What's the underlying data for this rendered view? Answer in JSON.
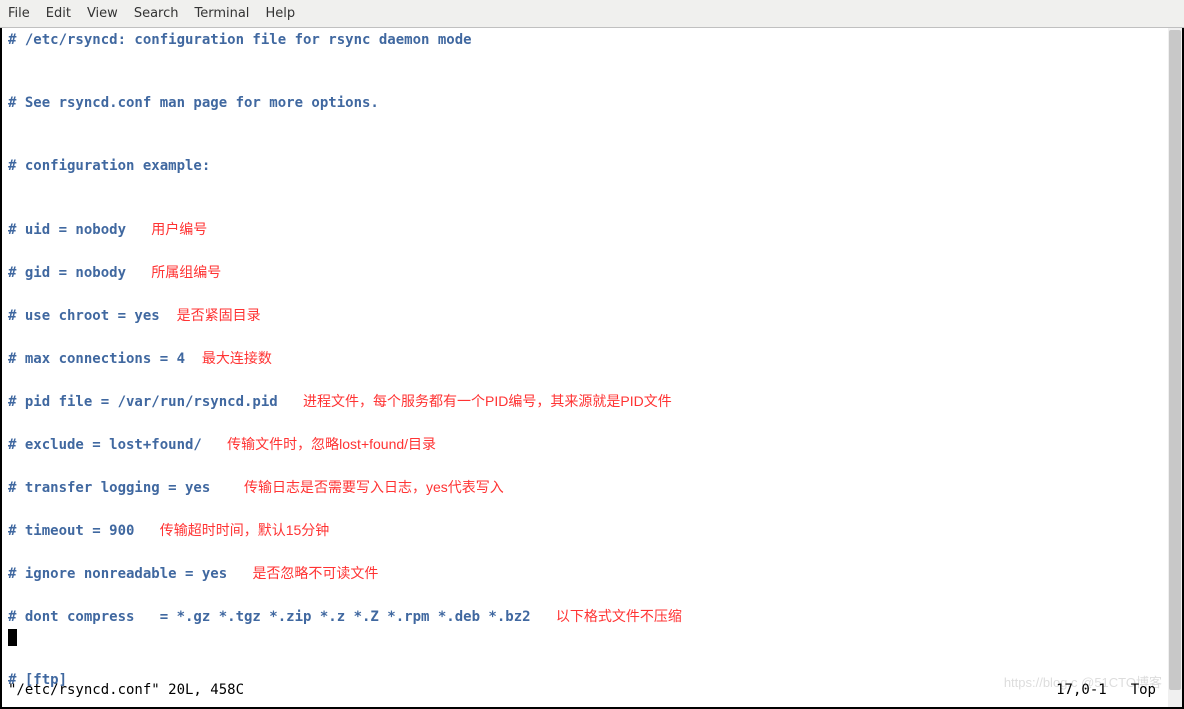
{
  "menubar": {
    "items": [
      {
        "label": "File"
      },
      {
        "label": "Edit"
      },
      {
        "label": "View"
      },
      {
        "label": "Search"
      },
      {
        "label": "Terminal"
      },
      {
        "label": "Help"
      }
    ]
  },
  "lines": [
    {
      "code": "# /etc/rsyncd: configuration file for rsync daemon mode",
      "note": ""
    },
    {
      "code": "",
      "note": ""
    },
    {
      "code": "",
      "note": ""
    },
    {
      "code": "# See rsyncd.conf man page for more options.",
      "note": ""
    },
    {
      "code": "",
      "note": ""
    },
    {
      "code": "",
      "note": ""
    },
    {
      "code": "# configuration example:",
      "note": ""
    },
    {
      "code": "",
      "note": ""
    },
    {
      "code": "",
      "note": ""
    },
    {
      "code": "# uid = nobody   ",
      "note": "用户编号"
    },
    {
      "code": "",
      "note": ""
    },
    {
      "code": "# gid = nobody   ",
      "note": "所属组编号"
    },
    {
      "code": "",
      "note": ""
    },
    {
      "code": "# use chroot = yes  ",
      "note": "是否紧固目录"
    },
    {
      "code": "",
      "note": ""
    },
    {
      "code": "# max connections = 4  ",
      "note": "最大连接数"
    },
    {
      "code": "",
      "note": ""
    },
    {
      "code": "# pid file = /var/run/rsyncd.pid   ",
      "note": "进程文件，每个服务都有一个PID编号，其来源就是PID文件"
    },
    {
      "code": "",
      "note": ""
    },
    {
      "code": "# exclude = lost+found/   ",
      "note": "传输文件时，忽略lost+found/目录"
    },
    {
      "code": "",
      "note": ""
    },
    {
      "code": "# transfer logging = yes    ",
      "note": "传输日志是否需要写入日志，yes代表写入"
    },
    {
      "code": "",
      "note": ""
    },
    {
      "code": "# timeout = 900   ",
      "note": "传输超时时间，默认15分钟"
    },
    {
      "code": "",
      "note": ""
    },
    {
      "code": "# ignore nonreadable = yes   ",
      "note": "是否忽略不可读文件"
    },
    {
      "code": "",
      "note": ""
    },
    {
      "code": "# dont compress   = *.gz *.tgz *.zip *.z *.Z *.rpm *.deb *.bz2   ",
      "note": "以下格式文件不压缩"
    },
    {
      "code": "",
      "note": "",
      "cursor": true
    },
    {
      "code": "",
      "note": ""
    },
    {
      "code": "# [ftp]",
      "note": ""
    }
  ],
  "status": {
    "left": "\"/etc/rsyncd.conf\" 20L, 458C",
    "position": "17,0-1",
    "scroll": "Top"
  },
  "watermark": "https://blog.c        @51CTO博客"
}
